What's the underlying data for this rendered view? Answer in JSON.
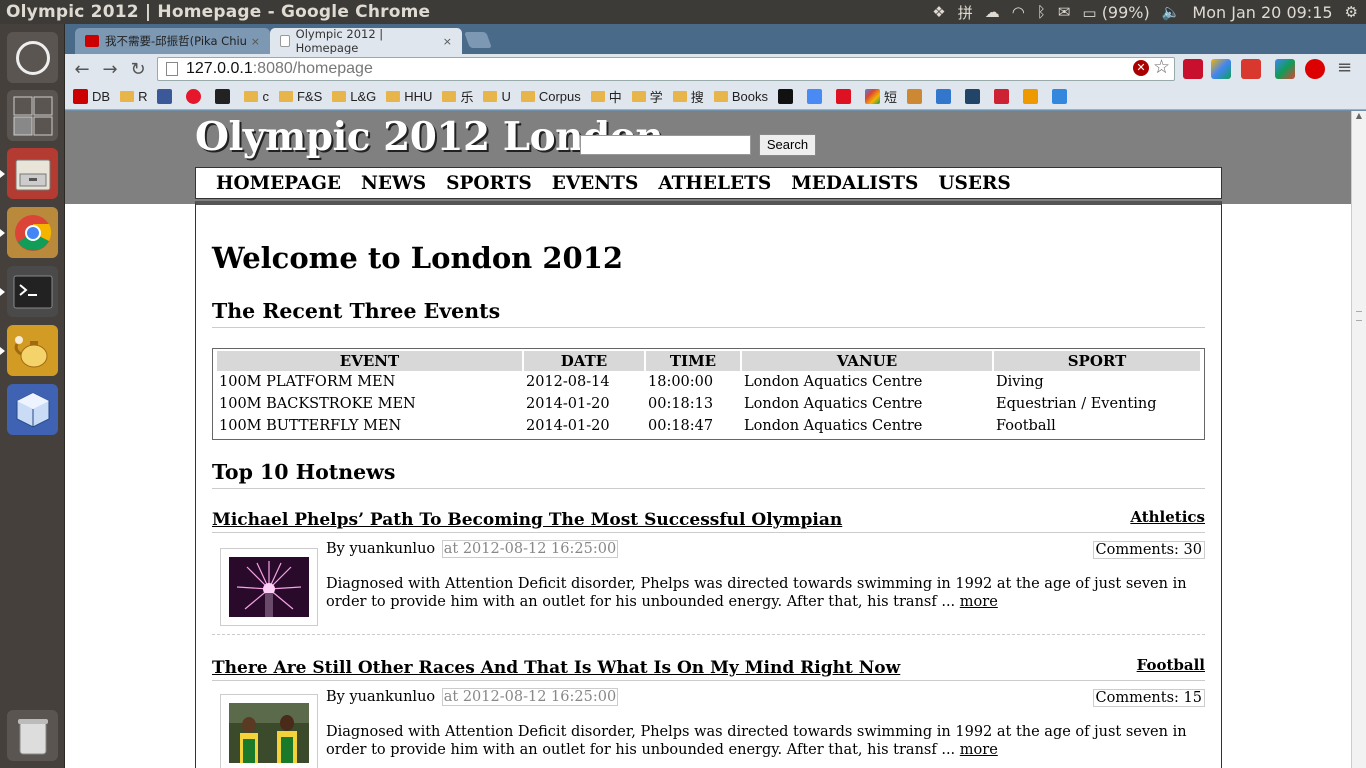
{
  "window": {
    "title": "Olympic 2012 | Homepage - Google Chrome"
  },
  "top_panel": {
    "battery": "(99%)",
    "clock": "Mon Jan 20  09:15"
  },
  "tabs": [
    {
      "label": "我不需要-邱振哲(Pika Chiu",
      "close": "×"
    },
    {
      "label": "Olympic 2012 | Homepage",
      "close": "×"
    }
  ],
  "address_bar": {
    "host": "127.0.0.1",
    "path": ":8080/homepage"
  },
  "bookmarks": {
    "items": [
      "DB",
      "R",
      "c",
      "F&S",
      "L&G",
      "HHU",
      "乐",
      "U",
      "Corpus",
      "中",
      "学",
      "搜",
      "Books",
      "短"
    ]
  },
  "site": {
    "title": "Olympic 2012 London",
    "search_button": "Search",
    "search_value": "",
    "nav": [
      "HOMEPAGE",
      "NEWS",
      "SPORTS",
      "EVENTS",
      "ATHELETS",
      "MEDALISTS",
      "USERS"
    ],
    "welcome": "Welcome to London 2012",
    "events_heading": "The Recent Three Events",
    "events_table": {
      "headers": [
        "EVENT",
        "DATE",
        "TIME",
        "VANUE",
        "SPORT"
      ],
      "rows": [
        [
          "100M PLATFORM MEN",
          "2012-08-14",
          "18:00:00",
          "London Aquatics Centre",
          "Diving"
        ],
        [
          "100M BACKSTROKE MEN",
          "2014-01-20",
          "00:18:13",
          "London Aquatics Centre",
          "Equestrian / Eventing"
        ],
        [
          "100M BUTTERFLY MEN",
          "2014-01-20",
          "00:18:47",
          "London Aquatics Centre",
          "Football"
        ]
      ]
    },
    "hotnews_heading": "Top 10 Hotnews",
    "news": [
      {
        "title": "Michael Phelps’ Path To Becoming The Most Successful Olympian",
        "category": "Athletics",
        "by": "By yuankunluo",
        "at": "at 2012-08-12 16:25:00",
        "comments": "Comments: 30",
        "body": "Diagnosed with Attention Deficit disorder, Phelps was directed towards swimming in 1992 at the age of just seven in order to provide him with an outlet for his unbounded energy. After that, his transf ...",
        "more": "more"
      },
      {
        "title": "There Are Still Other Races And That Is What Is On My Mind Right Now",
        "category": "Football",
        "by": "By yuankunluo",
        "at": "at 2012-08-12 16:25:00",
        "comments": "Comments: 15",
        "body": "Diagnosed with Attention Deficit disorder, Phelps was directed towards swimming in 1992 at the age of just seven in order to provide him with an outlet for his unbounded energy. After that, his transf ...",
        "more": "more"
      }
    ]
  }
}
